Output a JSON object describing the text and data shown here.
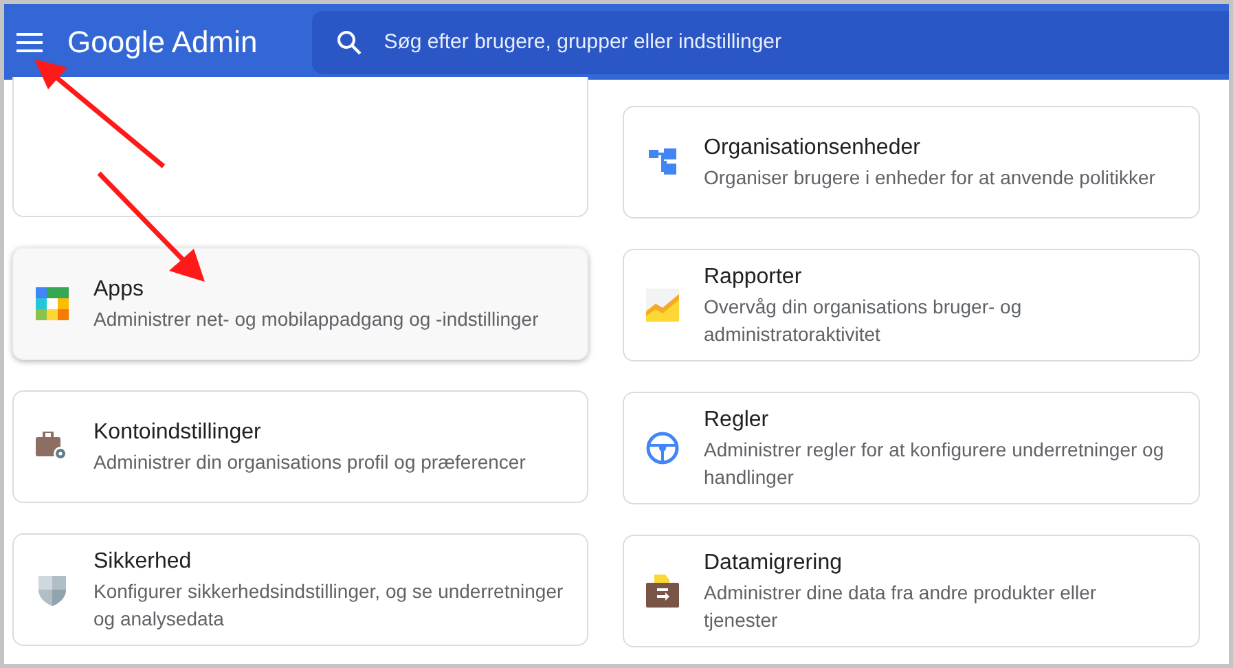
{
  "header": {
    "title": "Google Admin",
    "search": {
      "placeholder": "Søg efter brugere, grupper eller indstillinger"
    }
  },
  "columns": [
    {
      "cards": [
        {
          "kind": "blank"
        },
        {
          "kind": "card",
          "title": "Apps",
          "description": "Administrer net- og mobilappadgang og -indstillinger",
          "hovered": true
        },
        {
          "kind": "card",
          "title": "Kontoindstillinger",
          "description": "Administrer din organisations profil og præferencer",
          "hovered": false
        },
        {
          "kind": "card",
          "title": "Sikkerhed",
          "description": "Konfigurer sikkerhedsindstillinger, og se underretninger og analysedata",
          "hovered": false
        }
      ]
    },
    {
      "cards": [
        {
          "kind": "card",
          "title": "Organisationsenheder",
          "description": "Organiser brugere i enheder for at anvende politikker",
          "hovered": false
        },
        {
          "kind": "card",
          "title": "Rapporter",
          "description": "Overvåg din organisations bruger- og administratoraktivitet",
          "hovered": false
        },
        {
          "kind": "card",
          "title": "Regler",
          "description": "Administrer regler for at konfigurere underretninger og handlinger",
          "hovered": false
        },
        {
          "kind": "card",
          "title": "Datamigrering",
          "description": "Administrer dine data fra andre produkter eller tjenester",
          "hovered": false
        }
      ]
    }
  ]
}
